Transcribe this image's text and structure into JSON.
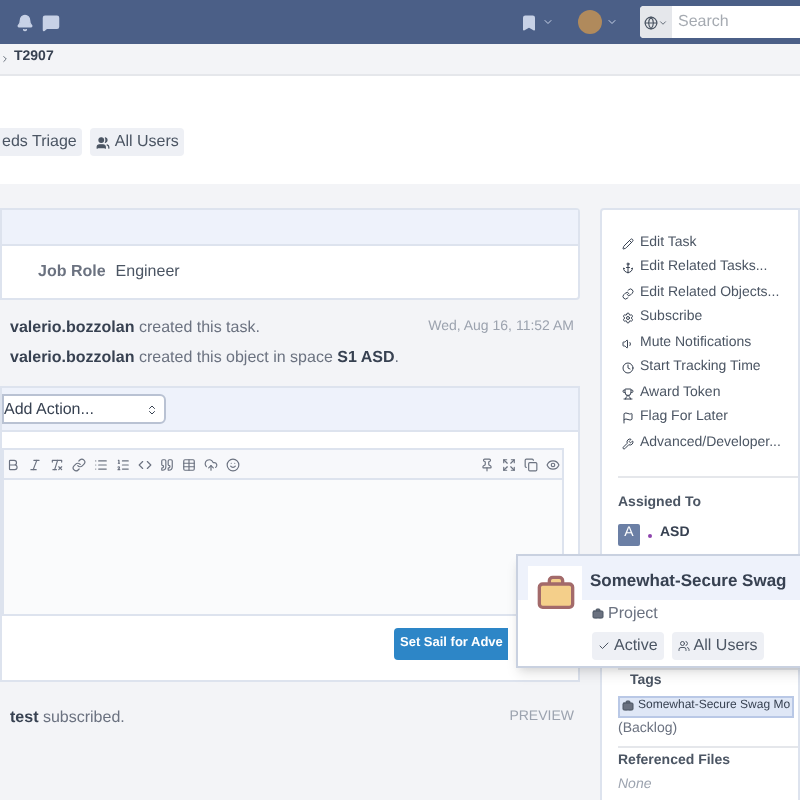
{
  "navbar": {
    "search": {
      "placeholder": "Search"
    }
  },
  "breadcrumb": {
    "current": "T2907"
  },
  "header": {
    "tags": [
      "eds Triage",
      "All Users"
    ]
  },
  "details": {
    "fields": [
      {
        "label": "Job Role",
        "value": "Engineer"
      }
    ]
  },
  "timeline": [
    {
      "text": "**valerio.bozzolan** created this task.",
      "time": "Wed, Aug 16, 11:52 AM"
    },
    {
      "text": "**valerio.bozzolan** created this object in space **S1 ASD**."
    }
  ],
  "comment": {
    "action_select": "Add Action...",
    "submit": "Set Sail for Adve"
  },
  "transactions": [
    {
      "text": "**test** subscribed.",
      "badge": "PREVIEW"
    }
  ],
  "sidebar": {
    "actions": [
      "Edit Task",
      "Edit Related Tasks...",
      "Edit Related Objects...",
      "Subscribe",
      "Mute Notifications",
      "Start Tracking Time",
      "Award Token",
      "Flag For Later",
      "Advanced/Developer..."
    ],
    "assigned_label": "Assigned To",
    "assignee_initial": "A",
    "assignee": "ASD",
    "tags_label": "Tags",
    "tag": "Somewhat-Secure Swag Mo",
    "tag_note": "(Backlog)",
    "files_label": "Referenced Files",
    "files_value": "None"
  },
  "popover": {
    "title": "Somewhat-Secure Swag",
    "type": "Project",
    "tags": [
      "Active",
      "All Users"
    ]
  }
}
